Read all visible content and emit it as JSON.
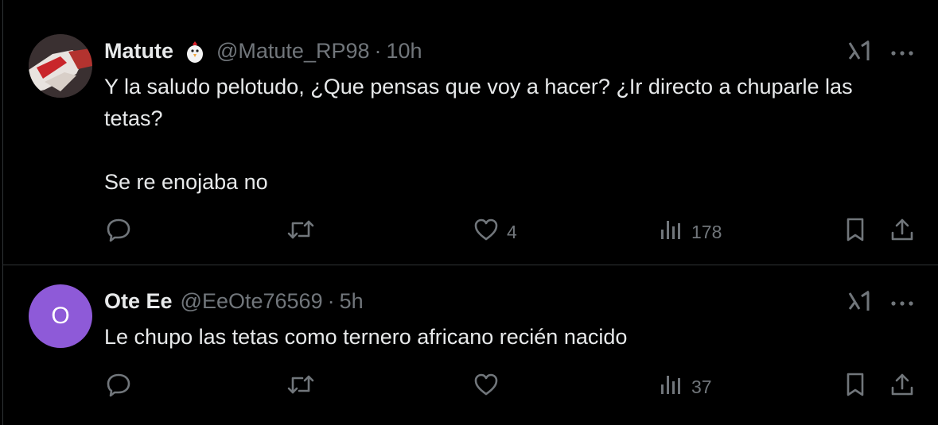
{
  "tweets": [
    {
      "name": "Matute",
      "handle": "@Matute_RP98",
      "time": "10h",
      "text_lines": [
        "Y la saludo pelotudo, ¿Que pensas que voy a hacer? ¿Ir directo a chuparle las tetas?",
        "Se re enojaba no"
      ],
      "replies": "",
      "retweets": "",
      "likes": "4",
      "views": "178"
    },
    {
      "name": "Ote Ee",
      "handle": "@EeOte76569",
      "time": "5h",
      "avatar_letter": "O",
      "text_lines": [
        "Le chupo las tetas como ternero africano recién nacido"
      ],
      "replies": "",
      "retweets": "",
      "likes": "",
      "views": "37"
    }
  ],
  "separator": "·",
  "icons": [
    "reply-icon",
    "retweet-icon",
    "like-icon",
    "views-icon",
    "bookmark-icon",
    "share-icon",
    "grok-icon",
    "more-icon",
    "chicken-emoji-icon"
  ],
  "colors": {
    "background": "#000000",
    "text": "#e7e9ea",
    "muted": "#71767b",
    "divider": "#2f3336",
    "avatar2": "#8e5ad8"
  }
}
